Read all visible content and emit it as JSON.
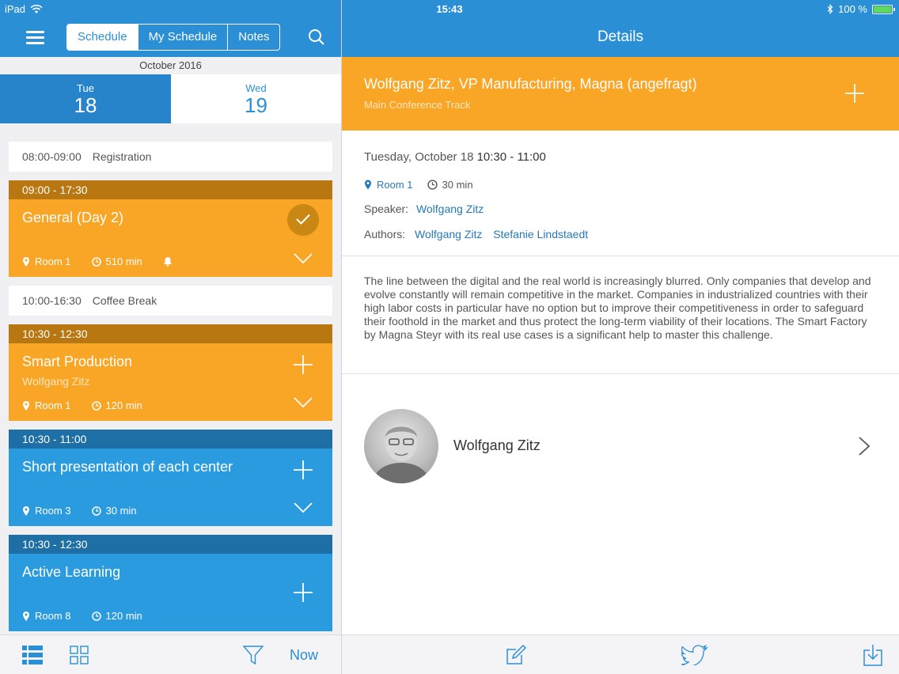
{
  "status": {
    "carrier": "iPad",
    "time": "15:43",
    "battery": "100 %"
  },
  "nav": {
    "tabs": [
      "Schedule",
      "My Schedule",
      "Notes"
    ],
    "right_title": "Details"
  },
  "calendar": {
    "month": "October 2016",
    "days": [
      {
        "name": "Tue",
        "num": "18"
      },
      {
        "name": "Wed",
        "num": "19"
      }
    ]
  },
  "sessions": {
    "registration": {
      "time": "08:00-09:00",
      "name": "Registration"
    },
    "general": {
      "time": "09:00 - 17:30",
      "title": "General (Day 2)",
      "room": "Room 1",
      "duration": "510 min"
    },
    "coffee": {
      "time": "10:00-16:30",
      "name": "Coffee Break"
    },
    "smart": {
      "time": "10:30 - 12:30",
      "title": "Smart Production",
      "speaker": "Wolfgang Zitz",
      "room": "Room 1",
      "duration": "120 min"
    },
    "short": {
      "time": "10:30 - 11:00",
      "title": "Short presentation of each center",
      "room": "Room 3",
      "duration": "30 min"
    },
    "active": {
      "time": "10:30 - 12:30",
      "title": "Active Learning",
      "room": "Room 8",
      "duration": "120 min"
    }
  },
  "bottom_left": {
    "now": "Now"
  },
  "details": {
    "title": "Wolfgang Zitz, VP Manufacturing, Magna (angefragt)",
    "track": "Main Conference Track",
    "date": "Tuesday, October 18",
    "time": "10:30 - 11:00",
    "room": "Room 1",
    "duration": "30 min",
    "speaker_label": "Speaker:",
    "speaker": "Wolfgang Zitz",
    "authors_label": "Authors:",
    "authors": [
      "Wolfgang Zitz",
      "Stefanie Lindstaedt"
    ],
    "description": "The line between the digital and the real world is increasingly blurred. Only companies that develop and evolve constantly will remain competitive in the market. Companies in industrialized countries with their high labor costs in particular have no option but to improve their competitiveness in order to safeguard their foothold in the market and thus protect the long-term viability of their locations. The Smart Factory by Magna Steyr with its real use cases is a significant help to master this challenge.",
    "speaker_card_name": "Wolfgang Zitz"
  },
  "colors": {
    "header": "#2b8fd6",
    "orange": "#f9a525",
    "blue": "#2b9be0"
  },
  "icons": [
    "wifi-icon",
    "bluetooth-icon",
    "battery-icon",
    "hamburger-icon",
    "search-icon",
    "location-pin-icon",
    "clock-icon",
    "bell-icon",
    "check-icon",
    "plus-icon",
    "chevron-down-icon",
    "list-view-icon",
    "grid-view-icon",
    "filter-icon",
    "compose-icon",
    "twitter-icon",
    "download-icon",
    "chevron-right-icon"
  ]
}
